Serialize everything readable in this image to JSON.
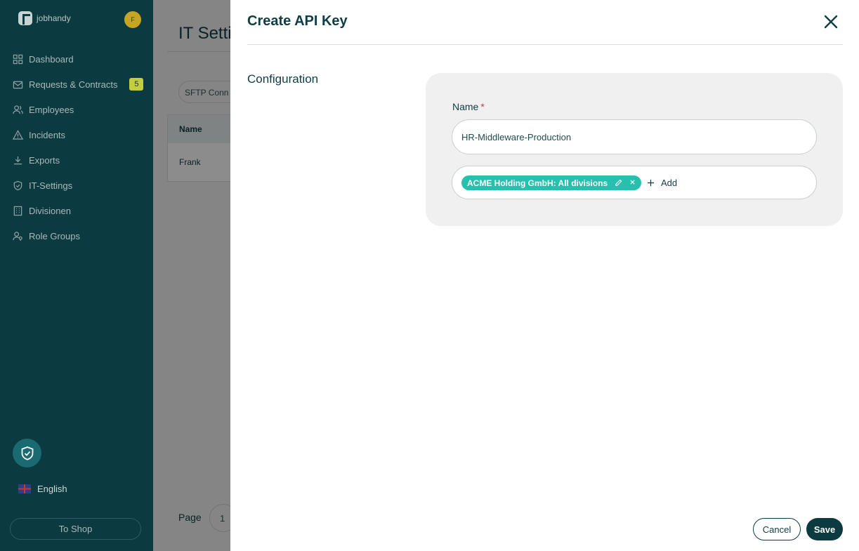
{
  "app": {
    "logo_text": "jobhandy",
    "avatar_initial": "F"
  },
  "sidebar": {
    "items": [
      {
        "label": "Dashboard",
        "icon": "grid-icon"
      },
      {
        "label": "Requests & Contracts",
        "icon": "mail-icon",
        "badge": "5"
      },
      {
        "label": "Employees",
        "icon": "users-icon"
      },
      {
        "label": "Incidents",
        "icon": "warning-icon"
      },
      {
        "label": "Exports",
        "icon": "download-icon"
      },
      {
        "label": "IT-Settings",
        "icon": "shield-icon"
      },
      {
        "label": "Divisionen",
        "icon": "building-icon"
      },
      {
        "label": "Role Groups",
        "icon": "user-key-icon"
      }
    ],
    "language": "English",
    "to_shop": "To Shop"
  },
  "background_page": {
    "title": "IT Setti",
    "filter_pill": "SFTP Conn",
    "table_header": "Name",
    "table_row": "Frank",
    "page_label": "Page",
    "page_value": "1"
  },
  "modal": {
    "title": "Create API Key",
    "section_label": "Configuration",
    "name_label": "Name",
    "required_mark": "*",
    "name_value": "HR-Middleware-Production",
    "chip_label": "ACME Holding GmbH: All divisions",
    "add_label": "Add",
    "cancel_label": "Cancel",
    "save_label": "Save"
  },
  "colors": {
    "sidebar_bg": "#0b3a40",
    "accent_teal": "#27bfae",
    "primary_dark": "#0b3a40",
    "badge_yellow": "#c3cd3d",
    "required_red": "#d9383a"
  }
}
